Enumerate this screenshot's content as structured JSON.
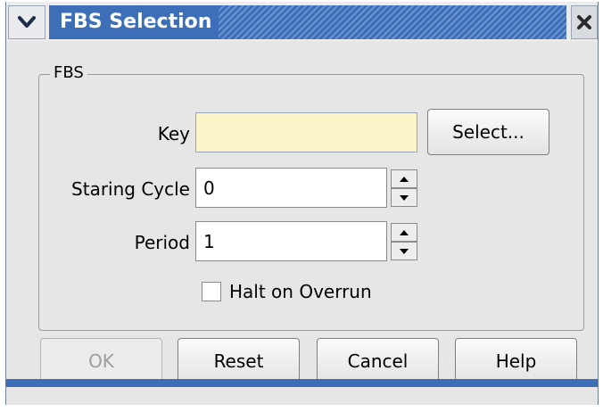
{
  "window": {
    "title": "FBS Selection",
    "menu_icon": "chevron-down-icon",
    "close_icon": "close-icon"
  },
  "group": {
    "title": "FBS"
  },
  "form": {
    "key_label": "Key",
    "key_value": "",
    "select_button": "Select...",
    "starting_cycle_label": "Staring Cycle",
    "starting_cycle_value": "0",
    "period_label": "Period",
    "period_value": "1",
    "halt_label": "Halt on Overrun",
    "halt_checked": false
  },
  "buttons": {
    "ok": "OK",
    "reset": "Reset",
    "cancel": "Cancel",
    "help": "Help"
  },
  "colors": {
    "title_bar": "#3d6fb8",
    "key_field_background": "#fbf4c9"
  }
}
